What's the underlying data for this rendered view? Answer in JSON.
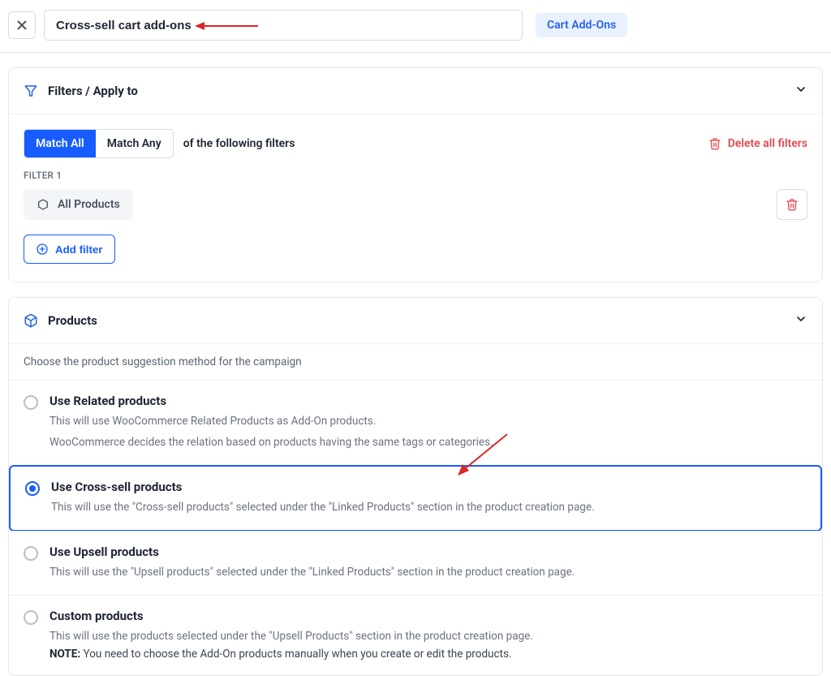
{
  "top": {
    "title_value": "Cross-sell cart add-ons",
    "type_badge": "Cart Add-Ons"
  },
  "filters": {
    "heading": "Filters / Apply to",
    "match_all": "Match All",
    "match_any": "Match Any",
    "match_suffix": "of the following filters",
    "delete_all": "Delete all filters",
    "filter_label": "FILTER 1",
    "chip": "All Products",
    "add_filter": "Add filter"
  },
  "products": {
    "heading": "Products",
    "subtitle": "Choose the product suggestion method for the campaign",
    "options": [
      {
        "title": "Use Related products",
        "desc": "This will use WooCommerce Related Products as Add-On products.",
        "desc2": "WooCommerce decides the relation based on products having the same tags or categories.",
        "selected": false
      },
      {
        "title": "Use Cross-sell products",
        "desc": "This will use the \"Cross-sell products\" selected under the \"Linked Products\" section in the product creation page.",
        "selected": true
      },
      {
        "title": "Use Upsell products",
        "desc": "This will use the \"Upsell products\" selected under the \"Linked Products\" section in the product creation page.",
        "selected": false
      },
      {
        "title": "Custom products",
        "desc": "This will use the products selected under the \"Upsell Products\" section in the product creation page.",
        "note_label": "NOTE:",
        "note_text": " You need to choose the Add-On products manually when you create or edit the products.",
        "selected": false
      }
    ]
  }
}
